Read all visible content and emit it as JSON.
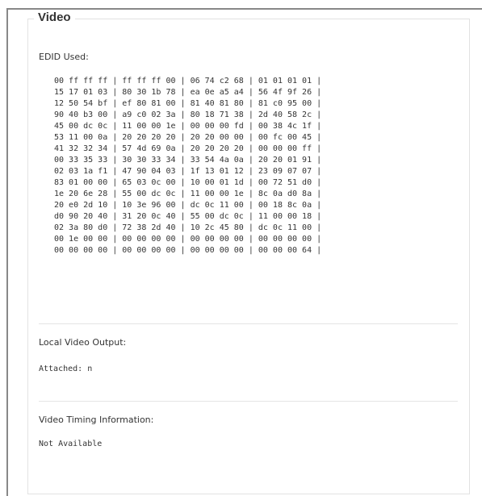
{
  "section_title": "Video",
  "edid": {
    "label": "EDID Used:",
    "rows": [
      "00 ff ff ff | ff ff ff 00 | 06 74 c2 68 | 01 01 01 01 |",
      "15 17 01 03 | 80 30 1b 78 | ea 0e a5 a4 | 56 4f 9f 26 |",
      "12 50 54 bf | ef 80 81 00 | 81 40 81 80 | 81 c0 95 00 |",
      "90 40 b3 00 | a9 c0 02 3a | 80 18 71 38 | 2d 40 58 2c |",
      "45 00 dc 0c | 11 00 00 1e | 00 00 00 fd | 00 38 4c 1f |",
      "53 11 00 0a | 20 20 20 20 | 20 20 00 00 | 00 fc 00 45 |",
      "41 32 32 34 | 57 4d 69 0a | 20 20 20 20 | 00 00 00 ff |",
      "00 33 35 33 | 30 30 33 34 | 33 54 4a 0a | 20 20 01 91 |",
      "02 03 1a f1 | 47 90 04 03 | 1f 13 01 12 | 23 09 07 07 |",
      "83 01 00 00 | 65 03 0c 00 | 10 00 01 1d | 00 72 51 d0 |",
      "1e 20 6e 28 | 55 00 dc 0c | 11 00 00 1e | 8c 0a d0 8a |",
      "20 e0 2d 10 | 10 3e 96 00 | dc 0c 11 00 | 00 18 8c 0a |",
      "d0 90 20 40 | 31 20 0c 40 | 55 00 dc 0c | 11 00 00 18 |",
      "02 3a 80 d0 | 72 38 2d 40 | 10 2c 45 80 | dc 0c 11 00 |",
      "00 1e 00 00 | 00 00 00 00 | 00 00 00 00 | 00 00 00 00 |",
      "00 00 00 00 | 00 00 00 00 | 00 00 00 00 | 00 00 00 64 |"
    ]
  },
  "local_output": {
    "label": "Local Video Output:",
    "value": "Attached: n"
  },
  "timing": {
    "label": "Video Timing Information:",
    "value": "Not Available"
  }
}
